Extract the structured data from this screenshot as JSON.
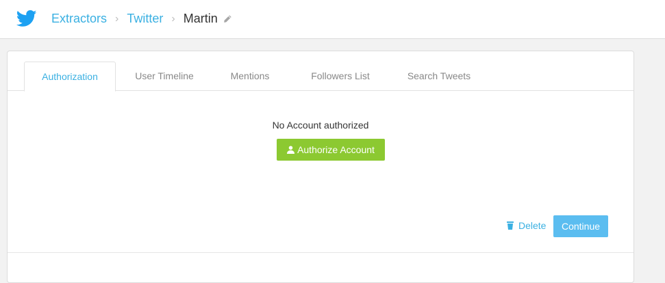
{
  "header": {
    "logo_icon": "twitter-bird-icon",
    "breadcrumbs": [
      "Extractors",
      "Twitter"
    ],
    "current": "Martin",
    "edit_icon": "pencil-icon"
  },
  "tabs": [
    {
      "label": "Authorization",
      "active": true
    },
    {
      "label": "User Timeline",
      "active": false
    },
    {
      "label": "Mentions",
      "active": false
    },
    {
      "label": "Followers List",
      "active": false
    },
    {
      "label": "Search Tweets",
      "active": false
    }
  ],
  "main": {
    "status_text": "No Account authorized",
    "authorize_label": "Authorize Account",
    "authorize_icon": "user-icon"
  },
  "footer": {
    "delete_label": "Delete",
    "delete_icon": "trash-icon",
    "continue_label": "Continue"
  },
  "colors": {
    "accent": "#3ab0e2",
    "authorize": "#8cc931",
    "continue": "#5bbdf0"
  }
}
